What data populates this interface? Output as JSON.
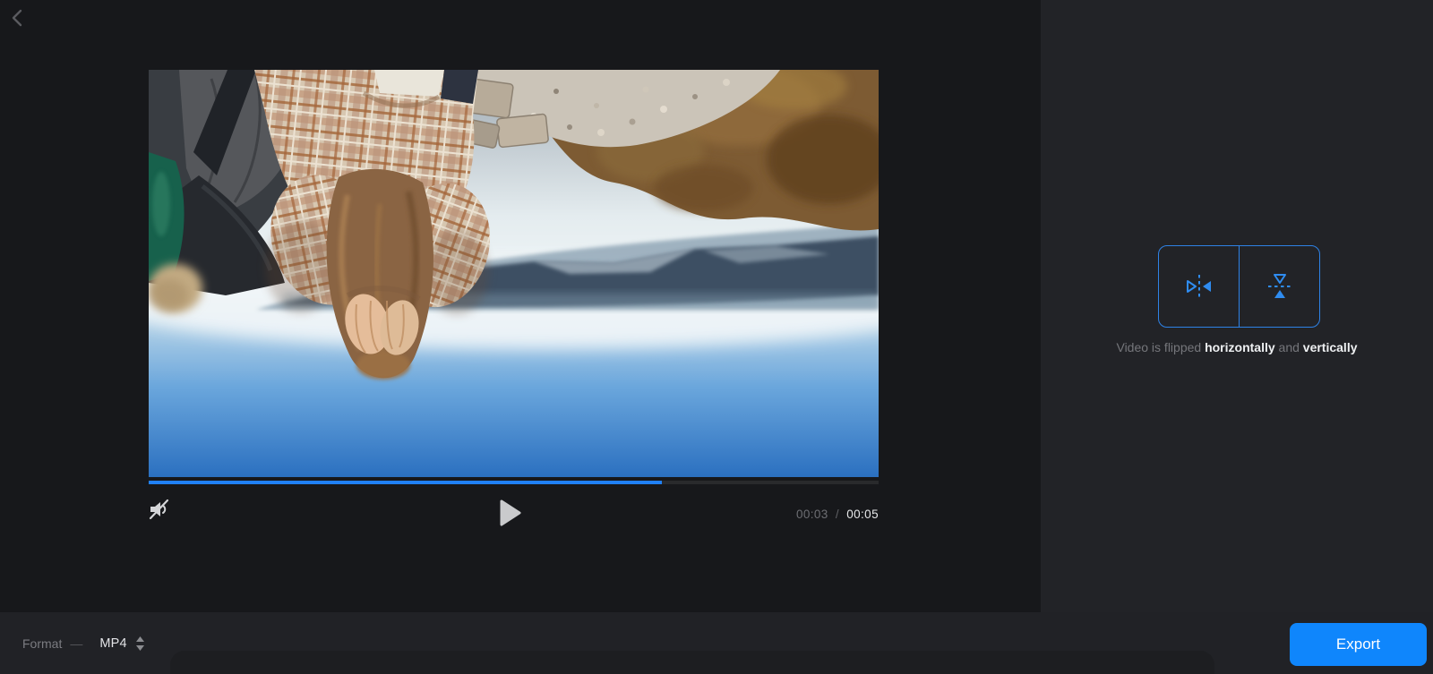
{
  "player": {
    "current_time": "00:03",
    "time_separator": "/",
    "total_time": "00:05",
    "progress_fill_style": "width:70.3%",
    "muted": "muted"
  },
  "flip_panel": {
    "caption_prefix": "Video is flipped",
    "caption_word_horizontal": "horizontally",
    "caption_and": "and",
    "caption_word_vertical": "vertically"
  },
  "footer": {
    "format_label": "Format",
    "format_dash": "—",
    "format_value": "MP4",
    "export_label": "Export"
  },
  "colors": {
    "accent_blue": "#0f86fc",
    "flip_border_blue": "#2e82e6",
    "progress_blue": "#2080f8",
    "main_bg": "#17181b",
    "panel_bg": "#222327",
    "footer_bg": "#212226"
  }
}
